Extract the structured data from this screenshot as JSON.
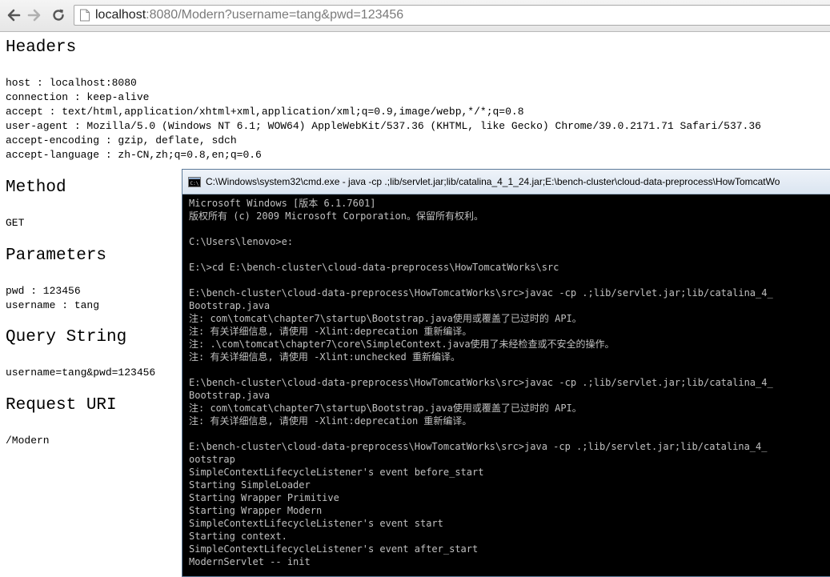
{
  "browser": {
    "url_host": "localhost",
    "url_rest": ":8080/Modern?username=tang&pwd=123456"
  },
  "headers": {
    "title": "Headers",
    "lines": [
      "host : localhost:8080",
      "connection : keep-alive",
      "accept : text/html,application/xhtml+xml,application/xml;q=0.9,image/webp,*/*;q=0.8",
      "user-agent : Mozilla/5.0 (Windows NT 6.1; WOW64) AppleWebKit/537.36 (KHTML, like Gecko) Chrome/39.0.2171.71 Safari/537.36",
      "accept-encoding : gzip, deflate, sdch",
      "accept-language : zh-CN,zh;q=0.8,en;q=0.6"
    ]
  },
  "method": {
    "title": "Method",
    "value": "GET"
  },
  "parameters": {
    "title": "Parameters",
    "lines": [
      "pwd : 123456",
      "username : tang"
    ]
  },
  "query_string": {
    "title": "Query String",
    "value": "username=tang&pwd=123456"
  },
  "request_uri": {
    "title": "Request URI",
    "value": "/Modern"
  },
  "console": {
    "title": "C:\\Windows\\system32\\cmd.exe - java  -cp .;lib/servlet.jar;lib/catalina_4_1_24.jar;E:\\bench-cluster\\cloud-data-preprocess\\HowTomcatWo",
    "lines": [
      "Microsoft Windows [版本 6.1.7601]",
      "版权所有 (c) 2009 Microsoft Corporation。保留所有权利。",
      "",
      "C:\\Users\\lenovo>e:",
      "",
      "E:\\>cd E:\\bench-cluster\\cloud-data-preprocess\\HowTomcatWorks\\src",
      "",
      "E:\\bench-cluster\\cloud-data-preprocess\\HowTomcatWorks\\src>javac -cp .;lib/servlet.jar;lib/catalina_4_",
      "Bootstrap.java",
      "注: com\\tomcat\\chapter7\\startup\\Bootstrap.java使用或覆盖了已过时的 API。",
      "注: 有关详细信息, 请使用 -Xlint:deprecation 重新编译。",
      "注: .\\com\\tomcat\\chapter7\\core\\SimpleContext.java使用了未经检查或不安全的操作。",
      "注: 有关详细信息, 请使用 -Xlint:unchecked 重新编译。",
      "",
      "E:\\bench-cluster\\cloud-data-preprocess\\HowTomcatWorks\\src>javac -cp .;lib/servlet.jar;lib/catalina_4_",
      "Bootstrap.java",
      "注: com\\tomcat\\chapter7\\startup\\Bootstrap.java使用或覆盖了已过时的 API。",
      "注: 有关详细信息, 请使用 -Xlint:deprecation 重新编译。",
      "",
      "E:\\bench-cluster\\cloud-data-preprocess\\HowTomcatWorks\\src>java -cp .;lib/servlet.jar;lib/catalina_4_",
      "ootstrap",
      "SimpleContextLifecycleListener's event before_start",
      "Starting SimpleLoader",
      "Starting Wrapper Primitive",
      "Starting Wrapper Modern",
      "SimpleContextLifecycleListener's event start",
      "Starting context.",
      "SimpleContextLifecycleListener's event after_start",
      "ModernServlet -- init"
    ]
  }
}
